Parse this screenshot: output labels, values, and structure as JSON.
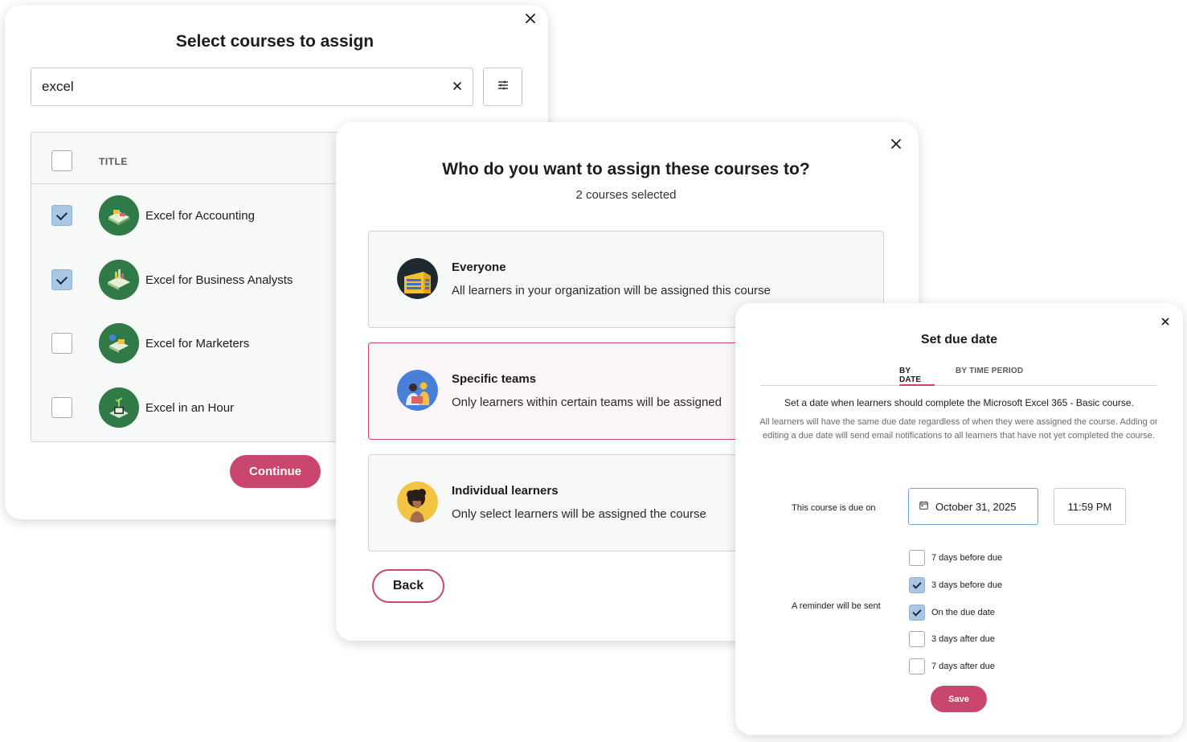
{
  "select_courses": {
    "title": "Select courses to assign",
    "search": {
      "value": "excel",
      "placeholder": ""
    },
    "table": {
      "column_title": "TITLE",
      "courses": [
        {
          "name": "Excel for Accounting",
          "checked": true,
          "icon": "ledger-illustration-icon"
        },
        {
          "name": "Excel for Business Analysts",
          "checked": true,
          "icon": "charts-illustration-icon"
        },
        {
          "name": "Excel for Marketers",
          "checked": false,
          "icon": "megaphone-illustration-icon"
        },
        {
          "name": "Excel in an Hour",
          "checked": false,
          "icon": "plant-device-illustration-icon"
        }
      ]
    },
    "continue_label": "Continue"
  },
  "assign_to": {
    "title": "Who do you want to assign these courses to?",
    "subtitle": "2 courses selected",
    "options": [
      {
        "title": "Everyone",
        "description": "All learners in your organization will be assigned this course",
        "selected": false,
        "icon": "building-icon"
      },
      {
        "title": "Specific teams",
        "description": "Only learners within certain teams will be assigned",
        "selected": true,
        "icon": "team-icon"
      },
      {
        "title": "Individual learners",
        "description": "Only select learners will be assigned the course",
        "selected": false,
        "icon": "person-icon"
      }
    ],
    "back_label": "Back"
  },
  "due_date": {
    "title": "Set due date",
    "tabs": [
      {
        "label": "BY DATE",
        "active": true
      },
      {
        "label": "BY TIME PERIOD",
        "active": false
      }
    ],
    "lead": "Set a date when learners should complete the Microsoft Excel 365 - Basic course.",
    "note": "All learners will have the same due date regardless of when they were assigned the course. Adding or editing a due date will send email notifications to all learners that have not yet completed the course.",
    "due_label": "This course is due on",
    "date_value": "October 31, 2025",
    "time_value": "11:59 PM",
    "reminder_label": "A reminder will be sent",
    "reminders": [
      {
        "label": "7 days before due",
        "checked": false
      },
      {
        "label": "3 days before due",
        "checked": true
      },
      {
        "label": "On the due date",
        "checked": true
      },
      {
        "label": "3 days after due",
        "checked": false
      },
      {
        "label": "7 days after due",
        "checked": false
      }
    ],
    "save_label": "Save"
  },
  "colors": {
    "accent": "#c9476e",
    "checkbox_checked": "#a9c7e5",
    "focus_border": "#7da2cc",
    "course_icon_bg": "#2f7a47"
  }
}
